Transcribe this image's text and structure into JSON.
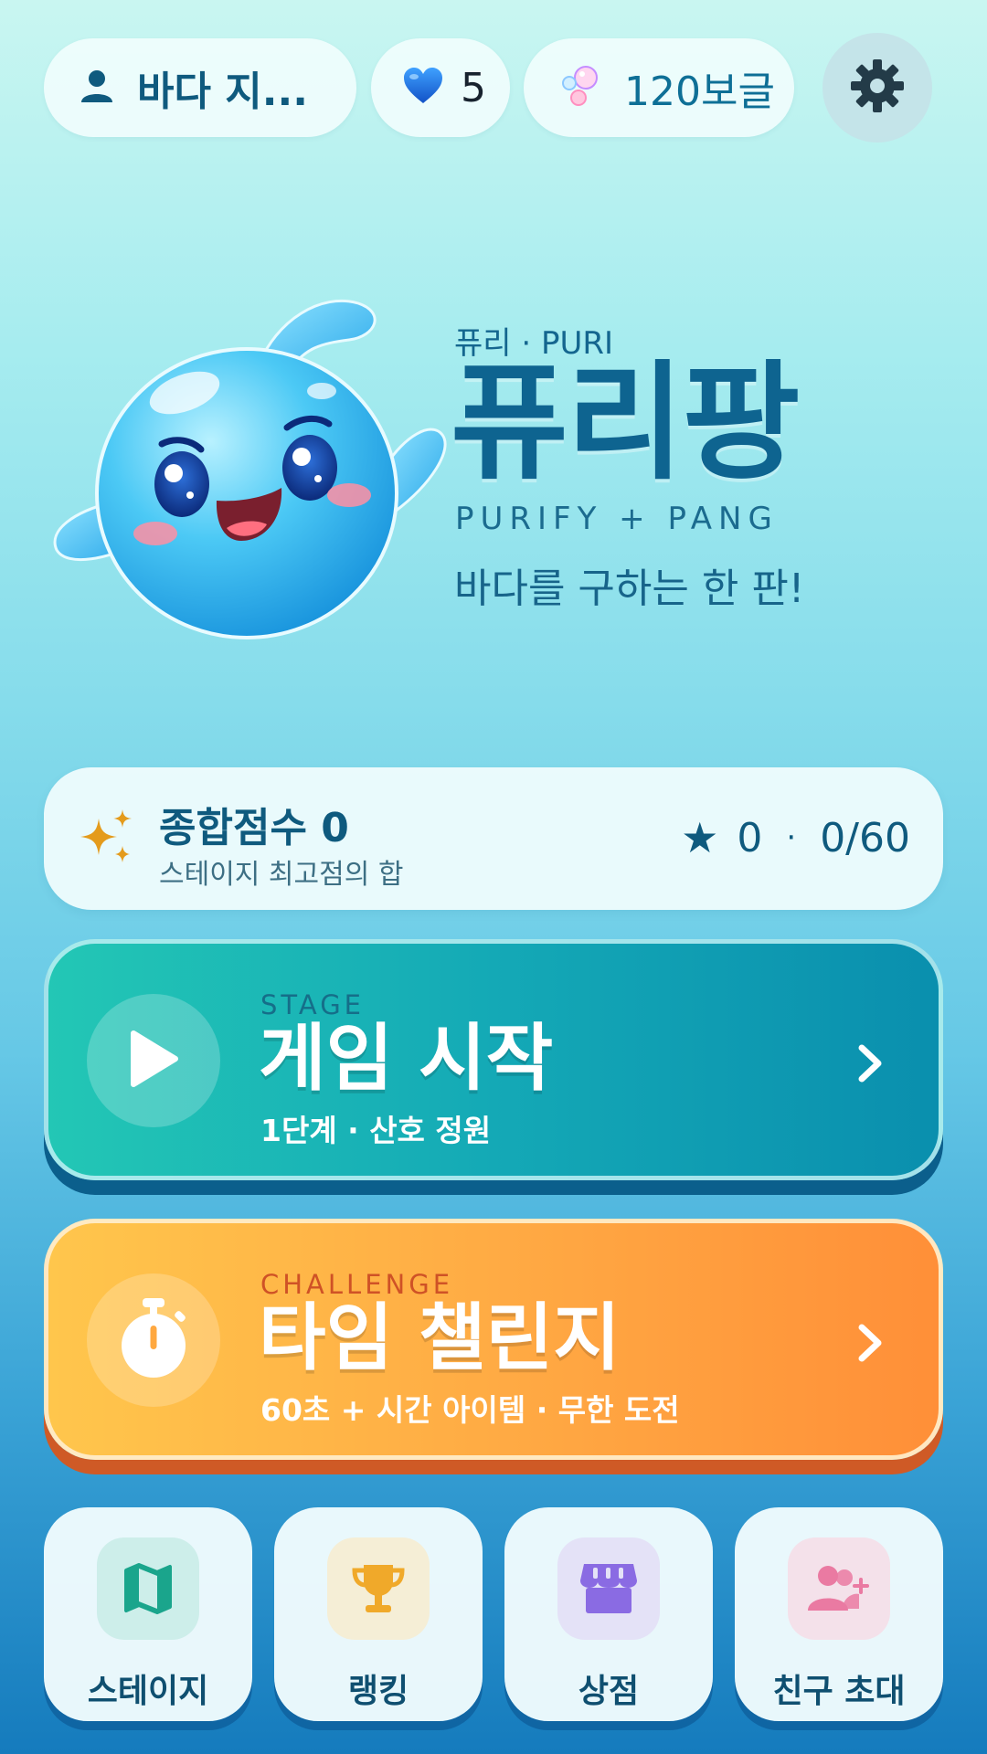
{
  "topbar": {
    "profile_name": "바다 지...",
    "hearts": "5",
    "bubbles": "120보글"
  },
  "hero": {
    "subtitle": "퓨리 · PURI",
    "title": "퓨리팡",
    "english": "PURIFY + PANG",
    "tagline": "바다를 구하는 한 판!"
  },
  "score": {
    "title": "종합점수 0",
    "subtitle": "스테이지 최고점의 합",
    "stars": "0",
    "separator": "·",
    "progress": "0/60"
  },
  "start_button": {
    "kicker": "STAGE",
    "title": "게임 시작",
    "subtitle": "1단계 · 산호 정원"
  },
  "challenge_button": {
    "kicker": "CHALLENGE",
    "title": "타임 챌린지",
    "subtitle": "60초 + 시간 아이템 · 무한 도전"
  },
  "bottom_nav": [
    {
      "label": "스테이지",
      "icon": "map-icon"
    },
    {
      "label": "랭킹",
      "icon": "trophy-icon"
    },
    {
      "label": "상점",
      "icon": "store-icon"
    },
    {
      "label": "친구 초대",
      "icon": "add-friend-icon"
    }
  ],
  "colors": {
    "start_gradient": [
      "#23c7b5",
      "#0a8fae"
    ],
    "challenge_gradient": [
      "#ffc64c",
      "#ff8f38"
    ],
    "title_blue": "#0e6490"
  }
}
